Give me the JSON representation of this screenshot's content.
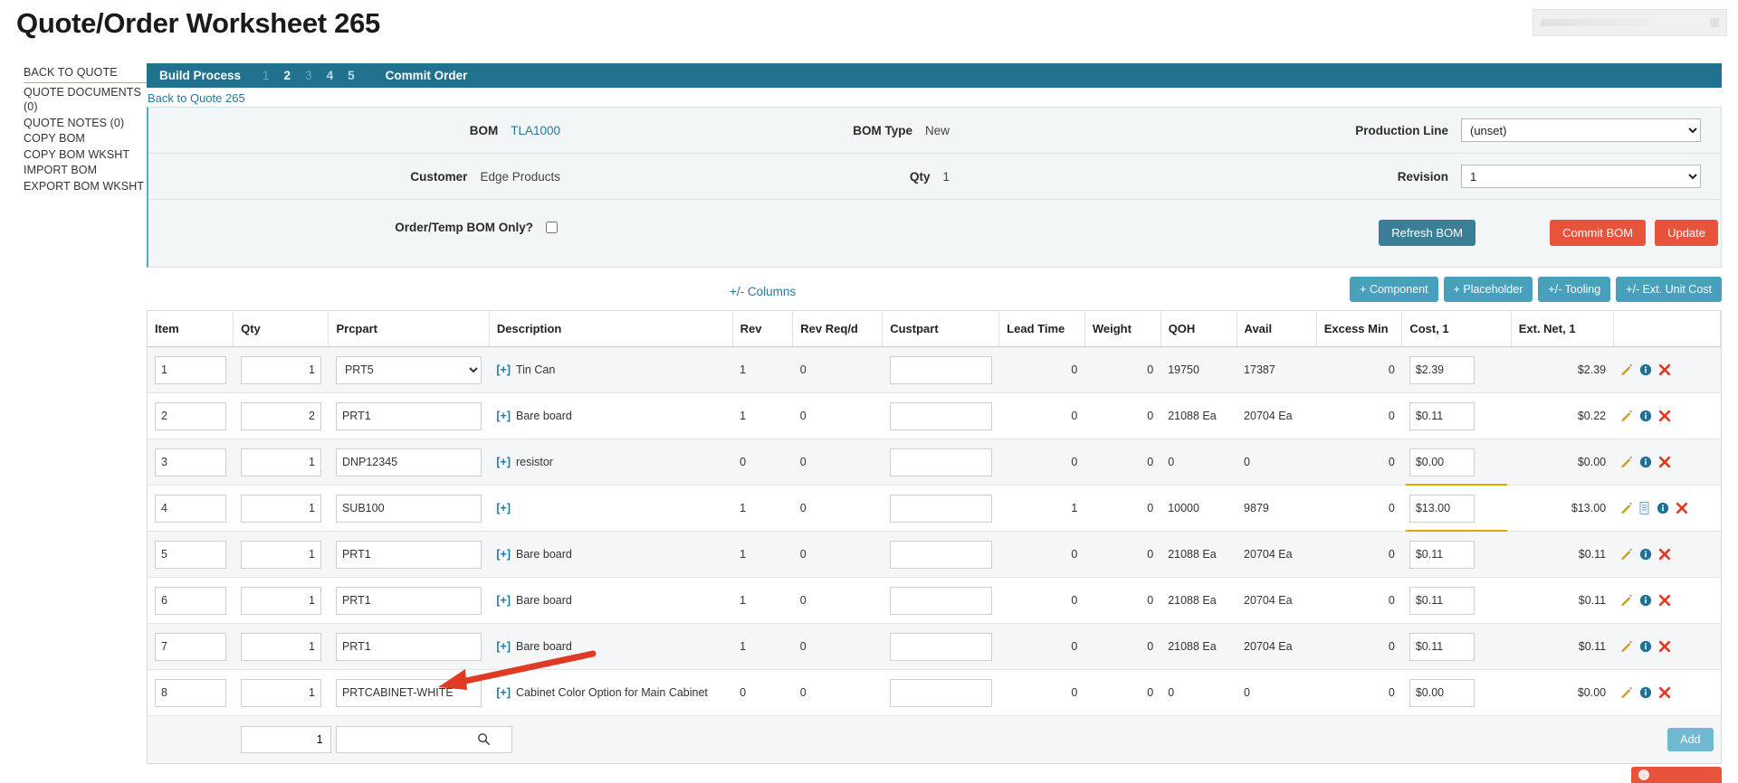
{
  "page_title": "Quote/Order Worksheet 265",
  "sidebar": {
    "items": [
      {
        "label": "BACK TO QUOTE",
        "name": "sidebar-item-back-to-quote"
      },
      {
        "label": "QUOTE DOCUMENTS (0)",
        "name": "sidebar-item-quote-documents"
      },
      {
        "label": "QUOTE NOTES (0)",
        "name": "sidebar-item-quote-notes"
      },
      {
        "label": "COPY BOM",
        "name": "sidebar-item-copy-bom"
      },
      {
        "label": "COPY BOM WKSHT",
        "name": "sidebar-item-copy-bom-wksht"
      },
      {
        "label": "IMPORT BOM",
        "name": "sidebar-item-import-bom"
      },
      {
        "label": "EXPORT BOM WKSHT",
        "name": "sidebar-item-export-bom-wksht"
      }
    ]
  },
  "build_process": {
    "title": "Build Process",
    "steps": [
      "1",
      "2",
      "3",
      "4",
      "5"
    ],
    "active_step": "2",
    "commit_label": "Commit Order"
  },
  "back_link": "Back to Quote 265",
  "info": {
    "bom_label": "BOM",
    "bom_value": "TLA1000",
    "bom_type_label": "BOM Type",
    "bom_type_value": "New",
    "production_line_label": "Production Line",
    "production_line_value": "(unset)",
    "production_line_options": [
      "(unset)"
    ],
    "customer_label": "Customer",
    "customer_value": "Edge Products",
    "qty_label": "Qty",
    "qty_value": "1",
    "revision_label": "Revision",
    "revision_value": "1",
    "revision_options": [
      "1"
    ],
    "order_temp_label": "Order/Temp BOM Only?",
    "order_temp_checked": false,
    "refresh_label": "Refresh BOM",
    "commit_bom_label": "Commit BOM",
    "update_label": "Update"
  },
  "toolbar": {
    "columns_toggle": "+/- Columns",
    "add_component": "+ Component",
    "add_placeholder": "+ Placeholder",
    "tooling": "+/- Tooling",
    "ext_unit_cost": "+/- Ext. Unit Cost"
  },
  "table": {
    "headers": [
      "Item",
      "Qty",
      "Prcpart",
      "Description",
      "Rev",
      "Rev Req/d",
      "Custpart",
      "Lead Time",
      "Weight",
      "QOH",
      "Avail",
      "Excess Min",
      "Cost, 1",
      "Ext. Net, 1",
      ""
    ],
    "rows": [
      {
        "item": "1",
        "qty": "1",
        "prcpart": "PRT5",
        "prcpart_type": "select",
        "description": "Tin Can",
        "rev": "1",
        "rev_reqd": "0",
        "custpart": "",
        "lead_time": "0",
        "weight": "0",
        "qoh": "19750",
        "avail": "17387",
        "excess_min": "0",
        "cost": "$2.39",
        "ext_net": "$2.39",
        "has_doc_icon": false,
        "cost_underline": false
      },
      {
        "item": "2",
        "qty": "2",
        "prcpart": "PRT1",
        "prcpart_type": "input",
        "description": "Bare board",
        "rev": "1",
        "rev_reqd": "0",
        "custpart": "",
        "lead_time": "0",
        "weight": "0",
        "qoh": "21088 Ea",
        "avail": "20704 Ea",
        "excess_min": "0",
        "cost": "$0.11",
        "ext_net": "$0.22",
        "has_doc_icon": false,
        "cost_underline": false
      },
      {
        "item": "3",
        "qty": "1",
        "prcpart": "DNP12345",
        "prcpart_type": "input",
        "description": "resistor",
        "rev": "0",
        "rev_reqd": "0",
        "custpart": "",
        "lead_time": "0",
        "weight": "0",
        "qoh": "0",
        "avail": "0",
        "excess_min": "0",
        "cost": "$0.00",
        "ext_net": "$0.00",
        "has_doc_icon": false,
        "cost_underline": true
      },
      {
        "item": "4",
        "qty": "1",
        "prcpart": "SUB100",
        "prcpart_type": "input",
        "description": "",
        "rev": "1",
        "rev_reqd": "0",
        "custpart": "",
        "lead_time": "1",
        "weight": "0",
        "qoh": "10000",
        "avail": "9879",
        "excess_min": "0",
        "cost": "$13.00",
        "ext_net": "$13.00",
        "has_doc_icon": true,
        "cost_underline": true
      },
      {
        "item": "5",
        "qty": "1",
        "prcpart": "PRT1",
        "prcpart_type": "input",
        "description": "Bare board",
        "rev": "1",
        "rev_reqd": "0",
        "custpart": "",
        "lead_time": "0",
        "weight": "0",
        "qoh": "21088 Ea",
        "avail": "20704 Ea",
        "excess_min": "0",
        "cost": "$0.11",
        "ext_net": "$0.11",
        "has_doc_icon": false,
        "cost_underline": false
      },
      {
        "item": "6",
        "qty": "1",
        "prcpart": "PRT1",
        "prcpart_type": "input",
        "description": "Bare board",
        "rev": "1",
        "rev_reqd": "0",
        "custpart": "",
        "lead_time": "0",
        "weight": "0",
        "qoh": "21088 Ea",
        "avail": "20704 Ea",
        "excess_min": "0",
        "cost": "$0.11",
        "ext_net": "$0.11",
        "has_doc_icon": false,
        "cost_underline": false
      },
      {
        "item": "7",
        "qty": "1",
        "prcpart": "PRT1",
        "prcpart_type": "input",
        "description": "Bare board",
        "rev": "1",
        "rev_reqd": "0",
        "custpart": "",
        "lead_time": "0",
        "weight": "0",
        "qoh": "21088 Ea",
        "avail": "20704 Ea",
        "excess_min": "0",
        "cost": "$0.11",
        "ext_net": "$0.11",
        "has_doc_icon": false,
        "cost_underline": false
      },
      {
        "item": "8",
        "qty": "1",
        "prcpart": "PRTCABINET-WHITE",
        "prcpart_type": "input",
        "description": "Cabinet Color Option for Main Cabinet",
        "rev": "0",
        "rev_reqd": "0",
        "custpart": "",
        "lead_time": "0",
        "weight": "0",
        "qoh": "0",
        "avail": "0",
        "excess_min": "0",
        "cost": "$0.00",
        "ext_net": "$0.00",
        "has_doc_icon": false,
        "cost_underline": false
      }
    ],
    "expand_marker": "[+]",
    "add_row": {
      "qty_value": "1",
      "search_value": "",
      "search_icon": "search-icon",
      "add_label": "Add"
    }
  },
  "colors": {
    "header_bar": "#21728f",
    "link": "#2778a0",
    "danger": "#e8533c",
    "accent_button": "#49a0bd",
    "annotation_arrow": "#e03a24"
  }
}
